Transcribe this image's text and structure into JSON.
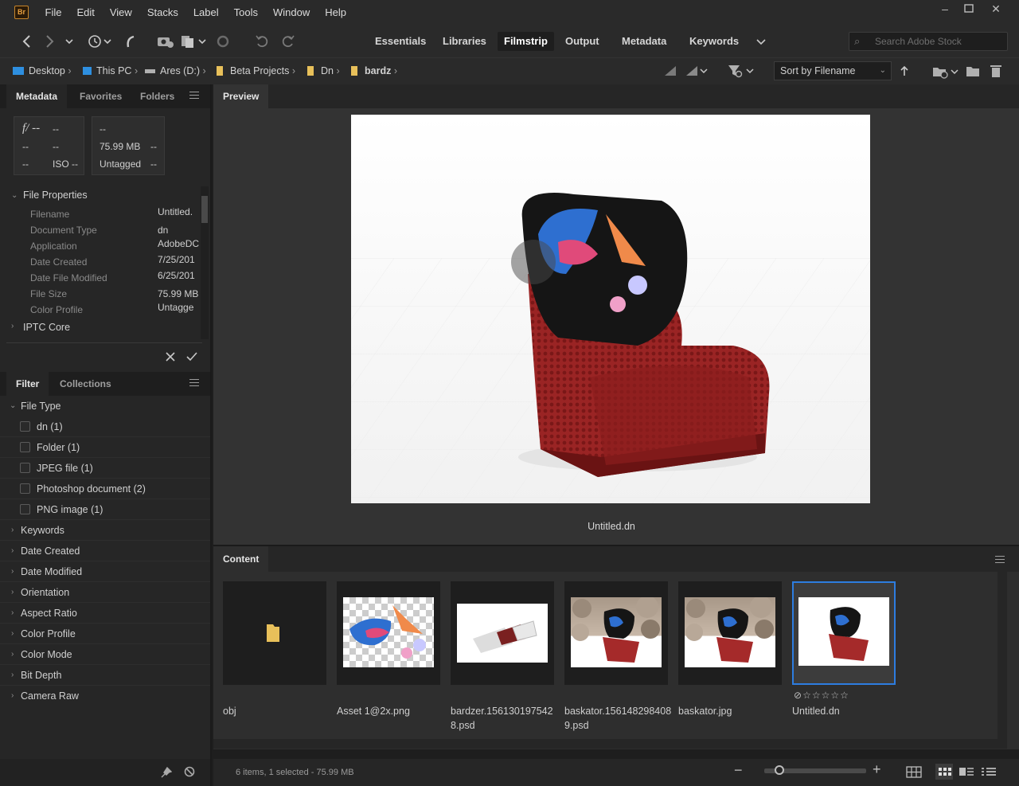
{
  "menubar": {
    "app_icon": "Br",
    "items": [
      "File",
      "Edit",
      "View",
      "Stacks",
      "Label",
      "Tools",
      "Window",
      "Help"
    ],
    "window_buttons": [
      "minimize-icon",
      "maximize-icon",
      "close-icon"
    ]
  },
  "toolbar": {
    "workspaces": [
      "Essentials",
      "Libraries",
      "Filmstrip",
      "Output",
      "Metadata",
      "Keywords"
    ],
    "active_workspace": "Filmstrip",
    "search_placeholder": "Search Adobe Stock"
  },
  "path": {
    "crumbs": [
      "Desktop",
      "This PC",
      "Ares (D:)",
      "Beta Projects",
      "Dn",
      "bardz"
    ],
    "sort_label": "Sort by Filename"
  },
  "metadata_panel": {
    "tabs": [
      "Metadata",
      "Favorites",
      "Folders"
    ],
    "camera_box": {
      "aperture": "f/ --",
      "c1": "--",
      "r2a": "--",
      "r2b": "--",
      "r3a": "--",
      "iso": "ISO --"
    },
    "file_box": {
      "r1": "--",
      "size": "75.99 MB",
      "size_dash": "--",
      "tag": "Untagged",
      "tag_dash": "--"
    },
    "section_file_properties": "File Properties",
    "properties": [
      {
        "label": "Filename",
        "value": "Untitled."
      },
      {
        "label": "Document Type",
        "value": "dn"
      },
      {
        "label": "Application",
        "value": "AdobeDC"
      },
      {
        "label": "Date Created",
        "value": "7/25/201"
      },
      {
        "label": "Date File Modified",
        "value": "6/25/201"
      },
      {
        "label": "File Size",
        "value": "75.99 MB"
      },
      {
        "label": "Color Profile",
        "value": "Untagge"
      }
    ],
    "section_iptc": "IPTC Core"
  },
  "filter_panel": {
    "tabs": [
      "Filter",
      "Collections"
    ],
    "file_type_label": "File Type",
    "file_types": [
      "dn (1)",
      "Folder (1)",
      "JPEG file (1)",
      "Photoshop document (2)",
      "PNG image (1)"
    ],
    "categories": [
      "Keywords",
      "Date Created",
      "Date Modified",
      "Orientation",
      "Aspect Ratio",
      "Color Profile",
      "Color Mode",
      "Bit Depth",
      "Camera Raw"
    ]
  },
  "preview": {
    "tab": "Preview",
    "filename": "Untitled.dn"
  },
  "content": {
    "tab": "Content",
    "items": [
      {
        "name": "obj",
        "kind": "folder"
      },
      {
        "name": "Asset 1@2x.png",
        "kind": "bird"
      },
      {
        "name": "bardzer.1561301975428.psd",
        "kind": "chairs"
      },
      {
        "name": "baskator.1561482984089.psd",
        "kind": "rocks"
      },
      {
        "name": "baskator.jpg",
        "kind": "rocks"
      },
      {
        "name": "Untitled.dn",
        "kind": "chair",
        "selected": true
      }
    ],
    "rating_stars": 5
  },
  "status": {
    "summary": "6 items, 1 selected - 75.99 MB",
    "zoom": 0.15
  }
}
